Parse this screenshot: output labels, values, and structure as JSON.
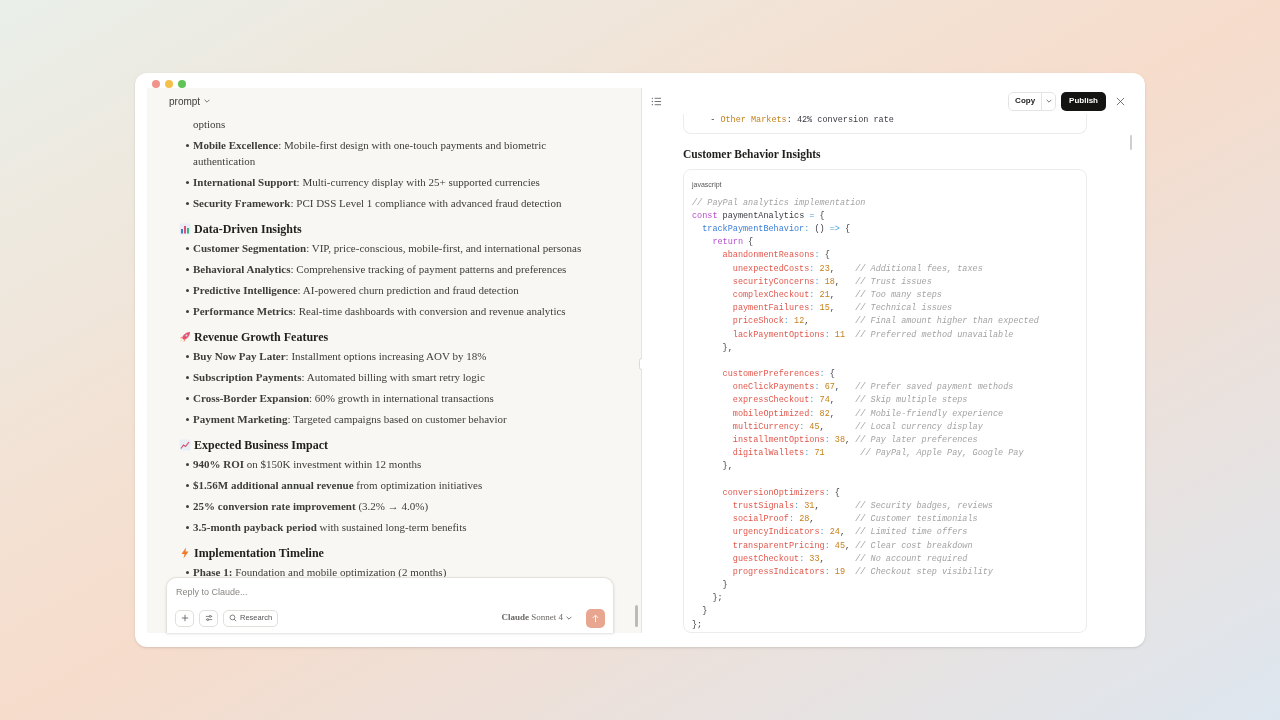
{
  "left_panel": {
    "title": "prompt",
    "lead_fragment": "options",
    "lead_items": [
      "**Mobile Excellence**: Mobile-first design with one-touch payments and biometric authentication",
      "**International Support**: Multi-currency display with 25+ supported currencies",
      "**Security Framework**: PCI DSS Level 1 compliance with advanced fraud detection"
    ],
    "sections": [
      {
        "kind": "chart",
        "heading": "Data-Driven Insights",
        "items": [
          "**Customer Segmentation**: VIP, price-conscious, mobile-first, and international personas",
          "**Behavioral Analytics**: Comprehensive tracking of payment patterns and preferences",
          "**Predictive Intelligence**: AI-powered churn prediction and fraud detection",
          "**Performance Metrics**: Real-time dashboards with conversion and revenue analytics"
        ]
      },
      {
        "kind": "rocket",
        "heading": "Revenue Growth Features",
        "items": [
          "**Buy Now Pay Later**: Installment options increasing AOV by 18%",
          "**Subscription Payments**: Automated billing with smart retry logic",
          "**Cross-Border Expansion**: 60% growth in international transactions",
          "**Payment Marketing**: Targeted campaigns based on customer behavior"
        ]
      },
      {
        "kind": "trend",
        "heading": "Expected Business Impact",
        "items": [
          "**940% ROI** on $150K investment within 12 months",
          "**$1.56M additional annual revenue** from optimization initiatives",
          "**25% conversion rate improvement** (3.2% → 4.0%)",
          "**3.5-month payback period** with sustained long-term benefits"
        ]
      },
      {
        "kind": "bolt",
        "heading": "Implementation Timeline",
        "items": [
          "**Phase 1:** Foundation and mobile optimization (2 months)"
        ]
      }
    ],
    "composer": {
      "placeholder": "Reply to Claude...",
      "research_label": "Research",
      "model": "**Claude** Sonnet 4"
    }
  },
  "right_panel": {
    "copy_label": "Copy",
    "publish_label": "Publish",
    "prev_block_line": {
      "tokens": [
        {
          "kind": "plain",
          "text": "  - "
        },
        {
          "kind": "label",
          "text": "Other Markets"
        },
        {
          "kind": "plain",
          "text": ": 42% conversion rate"
        }
      ]
    },
    "heading": "Customer Behavior Insights",
    "code": {
      "language": "javascript",
      "lines": [
        {
          "tokens": [
            {
              "kind": "comment",
              "text": "// PayPal analytics implementation"
            }
          ]
        },
        {
          "tokens": [
            {
              "kind": "keyword",
              "text": "const"
            },
            {
              "kind": "plain",
              "text": " paymentAnalytics "
            },
            {
              "kind": "operator",
              "text": "="
            },
            {
              "kind": "plain",
              "text": " {"
            }
          ]
        },
        {
          "tokens": [
            {
              "kind": "method",
              "text": "  trackPaymentBehavior"
            },
            {
              "kind": "operator",
              "text": ":"
            },
            {
              "kind": "plain",
              "text": " () "
            },
            {
              "kind": "operator",
              "text": "=>"
            },
            {
              "kind": "plain",
              "text": " {"
            }
          ]
        },
        {
          "tokens": [
            {
              "kind": "keyword",
              "text": "    return"
            },
            {
              "kind": "plain",
              "text": " {"
            }
          ]
        },
        {
          "tokens": [
            {
              "kind": "key",
              "text": "      abandonmentReasons"
            },
            {
              "kind": "operator",
              "text": ": "
            },
            {
              "kind": "plain",
              "text": "{"
            }
          ]
        },
        {
          "tokens": [
            {
              "kind": "key",
              "text": "        unexpectedCosts"
            },
            {
              "kind": "operator",
              "text": ": "
            },
            {
              "kind": "number",
              "text": "23"
            },
            {
              "kind": "plain",
              "text": ",    "
            },
            {
              "kind": "comment",
              "text": "// Additional fees, taxes"
            }
          ]
        },
        {
          "tokens": [
            {
              "kind": "key",
              "text": "        securityConcerns"
            },
            {
              "kind": "operator",
              "text": ": "
            },
            {
              "kind": "number",
              "text": "18"
            },
            {
              "kind": "plain",
              "text": ",   "
            },
            {
              "kind": "comment",
              "text": "// Trust issues"
            }
          ]
        },
        {
          "tokens": [
            {
              "kind": "key",
              "text": "        complexCheckout"
            },
            {
              "kind": "operator",
              "text": ": "
            },
            {
              "kind": "number",
              "text": "21"
            },
            {
              "kind": "plain",
              "text": ",    "
            },
            {
              "kind": "comment",
              "text": "// Too many steps"
            }
          ]
        },
        {
          "tokens": [
            {
              "kind": "key",
              "text": "        paymentFailures"
            },
            {
              "kind": "operator",
              "text": ": "
            },
            {
              "kind": "number",
              "text": "15"
            },
            {
              "kind": "plain",
              "text": ",    "
            },
            {
              "kind": "comment",
              "text": "// Technical issues"
            }
          ]
        },
        {
          "tokens": [
            {
              "kind": "key",
              "text": "        priceShock"
            },
            {
              "kind": "operator",
              "text": ": "
            },
            {
              "kind": "number",
              "text": "12"
            },
            {
              "kind": "plain",
              "text": ",         "
            },
            {
              "kind": "comment",
              "text": "// Final amount higher than expected"
            }
          ]
        },
        {
          "tokens": [
            {
              "kind": "key",
              "text": "        lackPaymentOptions"
            },
            {
              "kind": "operator",
              "text": ": "
            },
            {
              "kind": "number",
              "text": "11"
            },
            {
              "kind": "comment",
              "text": "  // Preferred method unavailable"
            }
          ]
        },
        {
          "tokens": [
            {
              "kind": "plain",
              "text": "      },"
            }
          ]
        },
        {
          "blank_before": true,
          "tokens": [
            {
              "kind": "key",
              "text": "      customerPreferences"
            },
            {
              "kind": "operator",
              "text": ": "
            },
            {
              "kind": "plain",
              "text": "{"
            }
          ]
        },
        {
          "tokens": [
            {
              "kind": "key",
              "text": "        oneClickPayments"
            },
            {
              "kind": "operator",
              "text": ": "
            },
            {
              "kind": "number",
              "text": "67"
            },
            {
              "kind": "plain",
              "text": ",   "
            },
            {
              "kind": "comment",
              "text": "// Prefer saved payment methods"
            }
          ]
        },
        {
          "tokens": [
            {
              "kind": "key",
              "text": "        expressCheckout"
            },
            {
              "kind": "operator",
              "text": ": "
            },
            {
              "kind": "number",
              "text": "74"
            },
            {
              "kind": "plain",
              "text": ",    "
            },
            {
              "kind": "comment",
              "text": "// Skip multiple steps"
            }
          ]
        },
        {
          "tokens": [
            {
              "kind": "key",
              "text": "        mobileOptimized"
            },
            {
              "kind": "operator",
              "text": ": "
            },
            {
              "kind": "number",
              "text": "82"
            },
            {
              "kind": "plain",
              "text": ",    "
            },
            {
              "kind": "comment",
              "text": "// Mobile-friendly experience"
            }
          ]
        },
        {
          "tokens": [
            {
              "kind": "key",
              "text": "        multiCurrency"
            },
            {
              "kind": "operator",
              "text": ": "
            },
            {
              "kind": "number",
              "text": "45"
            },
            {
              "kind": "plain",
              "text": ",      "
            },
            {
              "kind": "comment",
              "text": "// Local currency display"
            }
          ]
        },
        {
          "tokens": [
            {
              "kind": "key",
              "text": "        installmentOptions"
            },
            {
              "kind": "operator",
              "text": ": "
            },
            {
              "kind": "number",
              "text": "38"
            },
            {
              "kind": "plain",
              "text": ", "
            },
            {
              "kind": "comment",
              "text": "// Pay later preferences"
            }
          ]
        },
        {
          "tokens": [
            {
              "kind": "key",
              "text": "        digitalWallets"
            },
            {
              "kind": "operator",
              "text": ": "
            },
            {
              "kind": "number",
              "text": "71"
            },
            {
              "kind": "comment",
              "text": "       // PayPal, Apple Pay, Google Pay"
            }
          ]
        },
        {
          "tokens": [
            {
              "kind": "plain",
              "text": "      },"
            }
          ]
        },
        {
          "blank_before": true,
          "tokens": [
            {
              "kind": "key",
              "text": "      conversionOptimizers"
            },
            {
              "kind": "operator",
              "text": ": "
            },
            {
              "kind": "plain",
              "text": "{"
            }
          ]
        },
        {
          "tokens": [
            {
              "kind": "key",
              "text": "        trustSignals"
            },
            {
              "kind": "operator",
              "text": ": "
            },
            {
              "kind": "number",
              "text": "31"
            },
            {
              "kind": "plain",
              "text": ",       "
            },
            {
              "kind": "comment",
              "text": "// Security badges, reviews"
            }
          ]
        },
        {
          "tokens": [
            {
              "kind": "key",
              "text": "        socialProof"
            },
            {
              "kind": "operator",
              "text": ": "
            },
            {
              "kind": "number",
              "text": "28"
            },
            {
              "kind": "plain",
              "text": ",        "
            },
            {
              "kind": "comment",
              "text": "// Customer testimonials"
            }
          ]
        },
        {
          "tokens": [
            {
              "kind": "key",
              "text": "        urgencyIndicators"
            },
            {
              "kind": "operator",
              "text": ": "
            },
            {
              "kind": "number",
              "text": "24"
            },
            {
              "kind": "plain",
              "text": ",  "
            },
            {
              "kind": "comment",
              "text": "// Limited time offers"
            }
          ]
        },
        {
          "tokens": [
            {
              "kind": "key",
              "text": "        transparentPricing"
            },
            {
              "kind": "operator",
              "text": ": "
            },
            {
              "kind": "number",
              "text": "45"
            },
            {
              "kind": "plain",
              "text": ", "
            },
            {
              "kind": "comment",
              "text": "// Clear cost breakdown"
            }
          ]
        },
        {
          "tokens": [
            {
              "kind": "key",
              "text": "        guestCheckout"
            },
            {
              "kind": "operator",
              "text": ": "
            },
            {
              "kind": "number",
              "text": "33"
            },
            {
              "kind": "plain",
              "text": ",      "
            },
            {
              "kind": "comment",
              "text": "// No account required"
            }
          ]
        },
        {
          "tokens": [
            {
              "kind": "key",
              "text": "        progressIndicators"
            },
            {
              "kind": "operator",
              "text": ": "
            },
            {
              "kind": "number",
              "text": "19"
            },
            {
              "kind": "comment",
              "text": "  // Checkout step visibility"
            }
          ]
        },
        {
          "tokens": [
            {
              "kind": "plain",
              "text": "      }"
            }
          ]
        },
        {
          "tokens": [
            {
              "kind": "plain",
              "text": "    };"
            }
          ]
        },
        {
          "tokens": [
            {
              "kind": "plain",
              "text": "  }"
            }
          ]
        },
        {
          "tokens": [
            {
              "kind": "plain",
              "text": "};"
            }
          ]
        }
      ]
    }
  }
}
